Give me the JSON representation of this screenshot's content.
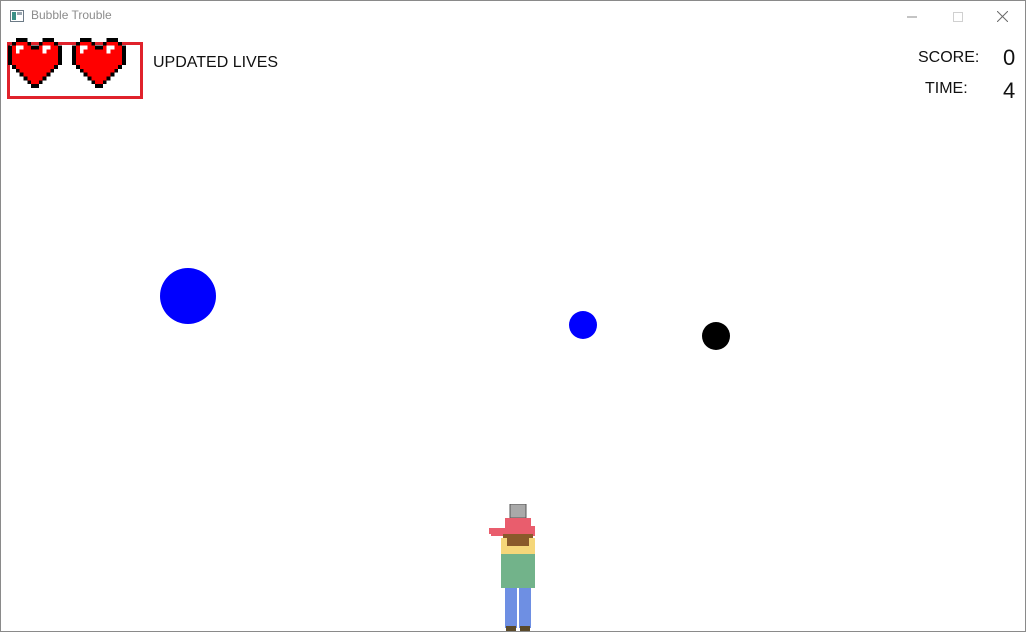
{
  "window": {
    "title": "Bubble Trouble",
    "controls": [
      "minimize-icon",
      "maximize-icon",
      "close-icon"
    ]
  },
  "hud": {
    "lives_label": "UPDATED LIVES",
    "lives_count": 2,
    "score_label": "SCORE:",
    "score_value": "0",
    "time_label": "TIME:",
    "time_value": "4",
    "highlight_color": "#e0222b"
  },
  "entities": {
    "heart_icon": "heart-icon",
    "heart_color": "#ff0000",
    "balls": [
      {
        "id": "ball-large",
        "color": "#0000ff"
      },
      {
        "id": "ball-small-blue",
        "color": "#0000ff"
      },
      {
        "id": "ball-small-black",
        "color": "#000000"
      }
    ],
    "player": {
      "cap_color": "#e95d6d",
      "shirt_color": "#72b38a",
      "pants_color": "#6e8fe3",
      "hair_color": "#8a5a2b",
      "gun_color": "#a9a9a9"
    }
  }
}
